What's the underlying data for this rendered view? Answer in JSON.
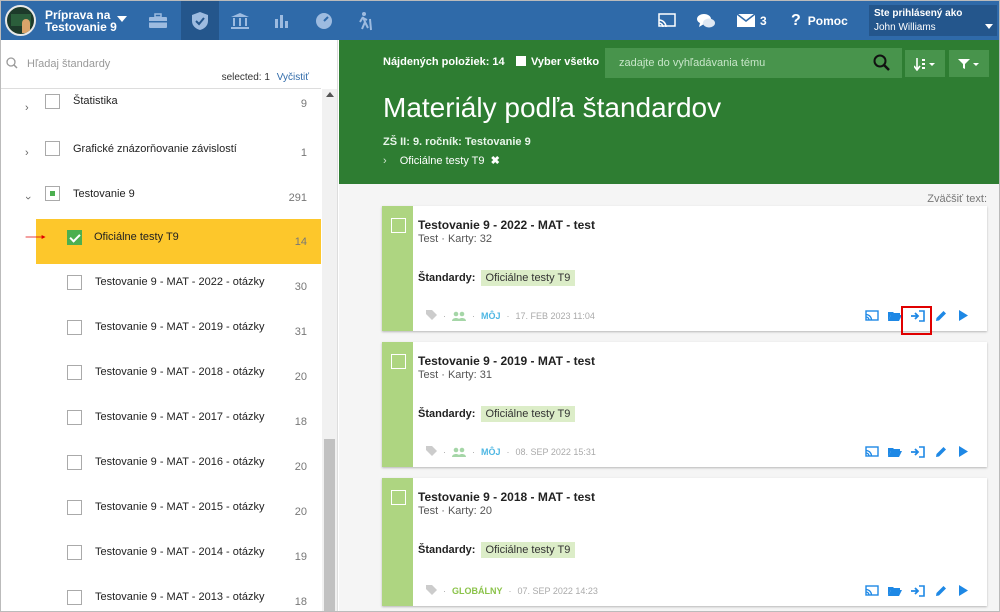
{
  "app": {
    "title": "Príprava na Testovanie 9"
  },
  "topbar": {
    "messages_count": "3",
    "help_label": "Pomoc",
    "user_line1": "Ste prihlásený ako",
    "user_name": "John Williams"
  },
  "sidebar": {
    "search_placeholder": "Hľadaj štandardy",
    "selected_label": "selected:",
    "selected_count": "1",
    "clear_label": "Vyčistiť",
    "items": [
      {
        "label": "Štatistika",
        "count": "9"
      },
      {
        "label": "Grafické znázorňovanie závislostí",
        "count": "1"
      },
      {
        "label": "Testovanie 9",
        "count": "291"
      },
      {
        "label": "Oficiálne testy T9",
        "count": "14"
      },
      {
        "label": "Testovanie 9 - MAT - 2022 - otázky",
        "count": "30"
      },
      {
        "label": "Testovanie 9 - MAT - 2019 - otázky",
        "count": "31"
      },
      {
        "label": "Testovanie 9 - MAT - 2018 - otázky",
        "count": "20"
      },
      {
        "label": "Testovanie 9 - MAT - 2017 - otázky",
        "count": "18"
      },
      {
        "label": "Testovanie 9 - MAT - 2016 - otázky",
        "count": "20"
      },
      {
        "label": "Testovanie 9 - MAT - 2015 - otázky",
        "count": "20"
      },
      {
        "label": "Testovanie 9 - MAT - 2014 - otázky",
        "count": "19"
      },
      {
        "label": "Testovanie 9 - MAT - 2013 - otázky",
        "count": "18"
      }
    ]
  },
  "main": {
    "found_label": "Nájdených položiek: 14",
    "select_all_label": "Vyber všetko",
    "search_placeholder": "zadajte do vyhľadávania tému",
    "title": "Materiály podľa štandardov",
    "subtitle": "ZŠ II: 9. ročník: Testovanie 9",
    "filter_label": "Oficiálne testy T9",
    "zoom_label": "Zväčšiť text:",
    "standards_label": "Štandardy:",
    "cards": [
      {
        "title": "Testovanie 9 - 2022 - MAT - test",
        "meta": "Test · Karty: 32",
        "tag": "Oficiálne testy T9",
        "owner": "MÔJ",
        "date": "17. FEB 2023 11:04"
      },
      {
        "title": "Testovanie 9 - 2019 - MAT - test",
        "meta": "Test · Karty: 31",
        "tag": "Oficiálne testy T9",
        "owner": "MÔJ",
        "date": "08. SEP 2022 15:31"
      },
      {
        "title": "Testovanie 9 - 2018 - MAT - test",
        "meta": "Test · Karty: 20",
        "tag": "Oficiálne testy T9",
        "owner": "GLOBÁLNY",
        "date": "07. SEP 2022 14:23"
      }
    ]
  },
  "colors": {
    "topbar": "#2f6aa9",
    "header": "#2e7d32",
    "active_row": "#fdc72b",
    "strip": "#aed581",
    "accent": "#1e88e5",
    "highlight": "#e00000"
  }
}
